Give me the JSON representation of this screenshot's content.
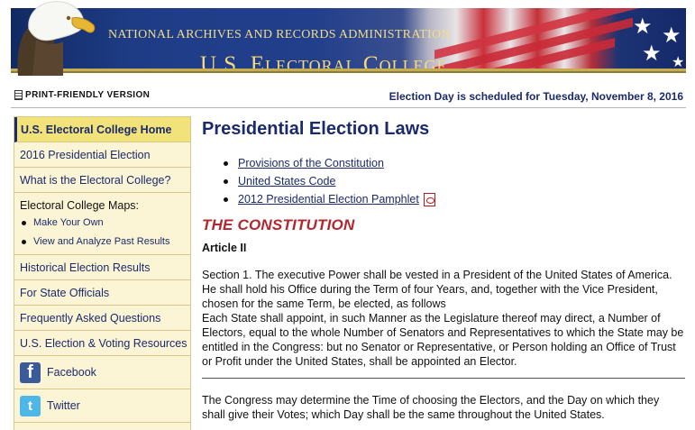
{
  "banner": {
    "agency": "NATIONAL ARCHIVES AND RECORDS ADMINISTRATION",
    "title": "U.S. Electoral College"
  },
  "topbar": {
    "print_label": "PRINT-FRIENDLY VERSION",
    "election_notice": "Election Day is scheduled for Tuesday, November 8, 2016"
  },
  "sidebar": {
    "home": "U.S. Electoral College Home",
    "items_top": [
      "2016 Presidential Election",
      "What is the Electoral College?"
    ],
    "maps": {
      "heading": "Electoral College Maps:",
      "subitems": [
        "Make Your Own",
        "View and Analyze Past Results"
      ]
    },
    "items_bottom": [
      "Historical Election Results",
      "For State Officials",
      "Frequently Asked Questions",
      "U.S. Election & Voting Resources"
    ],
    "social": [
      {
        "label": "Facebook",
        "icon": "facebook-icon"
      },
      {
        "label": "Twitter",
        "icon": "twitter-icon"
      }
    ]
  },
  "main": {
    "title": "Presidential Election Laws",
    "toc": [
      "Provisions of the Constitution",
      "United States Code",
      "2012 Presidential Election Pamphlet"
    ],
    "section_heading": "THE CONSTITUTION",
    "article_heading": "Article II",
    "para1": "Section 1. The executive Power shall be vested in a President of the United States of America. He shall hold his Office during the Term of four Years, and, together with the Vice President, chosen for the same Term, be elected, as follows",
    "para2": "Each State shall appoint, in such Manner as the Legislature thereof may direct, a Number of Electors, equal to the whole Number of Senators and Representatives to which the State may be entitled in the Congress: but no Senator or Representative, or Person holding an Office of Trust or Profit under the United States, shall be appointed an Elector.",
    "para3": "The Congress may determine the Time of choosing the Electors, and the Day on which they shall give their Votes; which Day shall be the same throughout the United States."
  },
  "colors": {
    "navy": "#1b2a6b",
    "accent_red": "#b3272e",
    "sidebar_bg": "#fbf5d6",
    "sidebar_active": "#f2e27a"
  }
}
